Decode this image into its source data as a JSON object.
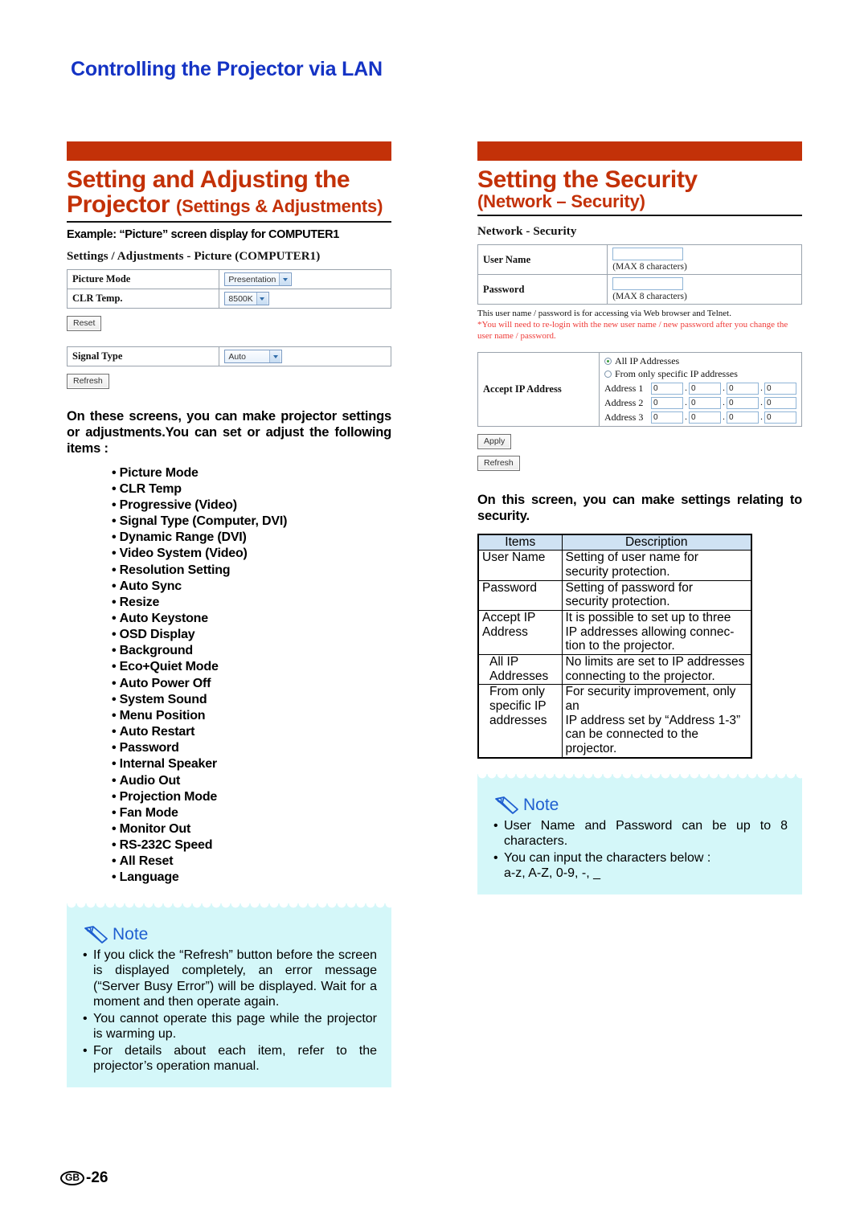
{
  "page": {
    "header": "Controlling the Projector via LAN",
    "footer_region": "GB",
    "footer_page": "-26"
  },
  "left": {
    "title_main": "Setting and Adjusting the",
    "title_line2_bold": "Projector ",
    "title_line2_sub": "(Settings & Adjustments)",
    "example_caption": "Example: “Picture” screen display for COMPUTER1",
    "mock": {
      "title": "Settings / Adjustments - Picture (COMPUTER1)",
      "rows": [
        {
          "label": "Picture Mode",
          "value": "Presentation"
        },
        {
          "label": "CLR Temp.",
          "value": "8500K"
        }
      ],
      "reset_button": "Reset",
      "signal_row": {
        "label": "Signal Type",
        "value": "Auto"
      },
      "refresh_button": "Refresh"
    },
    "intro": "On these screens, you can make projector settings or adjustments.You can set or adjust the following items :",
    "items": [
      "Picture Mode",
      "CLR Temp",
      "Progressive (Video)",
      "Signal Type (Computer, DVI)",
      "Dynamic Range (DVI)",
      "Video System (Video)",
      "Resolution Setting",
      "Auto Sync",
      "Resize",
      "Auto Keystone",
      "OSD Display",
      "Background",
      "Eco+Quiet Mode",
      "Auto Power Off",
      "System Sound",
      "Menu Position",
      "Auto Restart",
      "Password",
      "Internal Speaker",
      "Audio Out",
      "Projection Mode",
      "Fan Mode",
      "Monitor Out",
      "RS-232C Speed",
      "All Reset",
      "Language"
    ],
    "note": {
      "label": "Note",
      "bullets": [
        "If you click the “Refresh” button before the screen is displayed completely, an error message (“Server Busy Error”) will be displayed. Wait for a moment and then operate again.",
        "You cannot operate this page while the projector is warming up.",
        "For details about each item, refer to the projector’s operation manual."
      ]
    }
  },
  "right": {
    "title_main": "Setting the Security",
    "title_sub": "(Network – Security)",
    "mock": {
      "title": "Network - Security",
      "user_name_label": "User Name",
      "user_name_value": "",
      "user_name_hint": "(MAX 8 characters)",
      "password_label": "Password",
      "password_value": "",
      "password_hint": "(MAX 8 characters)",
      "note_line1": "This user name / password is for accessing via Web browser and Telnet.",
      "note_line2": "*You will need to re-login with the new user name / new password after you change the user name / password.",
      "accept_ip_label": "Accept IP Address",
      "radio_all": "All IP Addresses",
      "radio_specific": "From only specific IP addresses",
      "radio_selected": "all",
      "addresses": [
        {
          "label": "Address 1",
          "octets": [
            "0",
            "0",
            "0",
            "0"
          ]
        },
        {
          "label": "Address 2",
          "octets": [
            "0",
            "0",
            "0",
            "0"
          ]
        },
        {
          "label": "Address 3",
          "octets": [
            "0",
            "0",
            "0",
            "0"
          ]
        }
      ],
      "apply_button": "Apply",
      "refresh_button": "Refresh"
    },
    "intro": "On this screen, you can make settings relating to security.",
    "table": {
      "header_items": "Items",
      "header_description": "Description",
      "rows": [
        {
          "item": "User Name",
          "desc": "Setting of user name for\nsecurity protection.",
          "indent": false
        },
        {
          "item": "Password",
          "desc": "Setting of password for\nsecurity protection.",
          "indent": false
        },
        {
          "item": "Accept IP\nAddress",
          "desc": "It is possible to set up to three\nIP addresses allowing connec-\ntion to the projector.",
          "indent": false
        },
        {
          "item": "All IP\nAddresses",
          "desc": "No limits are set to IP addresses\nconnecting to the projector.",
          "indent": true
        },
        {
          "item": "From only\nspecific IP\naddresses",
          "desc": "For security improvement, only an\nIP address set by “Address 1-3”\ncan be connected to the projector.",
          "indent": true
        }
      ]
    },
    "note": {
      "label": "Note",
      "bullets": [
        "User Name and Password can be up to 8 characters.",
        "You can input the characters below :\na-z, A-Z, 0-9, -, _"
      ]
    }
  },
  "colors": {
    "header_blue": "#1433c4",
    "accent_orange": "#c33108",
    "note_bg": "#d4f7f9",
    "note_blue": "#1f5fd0",
    "table_header_blue": "#cfe2f3",
    "warn_red": "#ef3b38"
  }
}
